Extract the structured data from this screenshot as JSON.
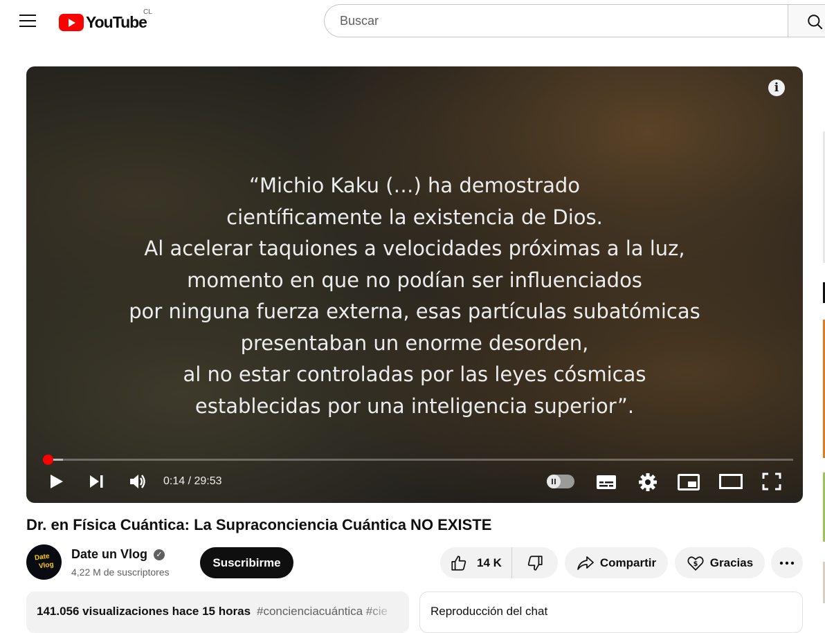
{
  "header": {
    "menu_icon": "hamburger-menu-icon",
    "logo_text": "YouTube",
    "country_code": "CL",
    "search_placeholder": "Buscar",
    "search_icon": "search-icon"
  },
  "player": {
    "quote_lines": [
      "“Michio Kaku (…) ha demostrado",
      "científicamente la existencia de Dios.",
      "Al acelerar taquiones a velocidades próximas a la luz,",
      "momento en que no podían ser influenciados",
      "por ninguna fuerza externa, esas partículas subatómicas",
      "presentaban un enorme desorden,",
      "al no estar controladas por las leyes cósmicas",
      "establecidas por una inteligencia superior”."
    ],
    "current_time": "0:14",
    "duration": "29:53",
    "time_display": "0:14 / 29:53",
    "progress_fraction": 0.0078,
    "buffered_fraction": 0.027,
    "controls": [
      "play-icon",
      "next-icon",
      "volume-icon",
      "autoplay-toggle",
      "subtitles-icon",
      "settings-icon",
      "miniplayer-icon",
      "theater-mode-icon",
      "fullscreen-icon"
    ],
    "info_icon": "info-icon"
  },
  "video": {
    "title": "Dr. en Física Cuántica: La Supraconciencia Cuántica NO EXISTE"
  },
  "channel": {
    "name": "Date un Vlog",
    "avatar_text_line1": "Date",
    "avatar_text_line2": "Vlog",
    "subscribers": "4,22 M de suscriptores",
    "subscribe_label": "Suscribirme",
    "verified_icon": "verified-badge-icon"
  },
  "actions": {
    "like_count": "14 K",
    "share_label": "Compartir",
    "thanks_label": "Gracias",
    "more_icon": "more-options-icon"
  },
  "description": {
    "views": "141.056 visualizaciones",
    "published": "hace 15 horas",
    "views_line": "141.056 visualizaciones  hace 15 horas",
    "tags": "#concienciacuántica #cie"
  },
  "chat": {
    "label": "Reproducción del chat"
  },
  "colors": {
    "brand_red": "#ff0000",
    "text_primary": "#0f0f0f",
    "text_secondary": "#606060",
    "chip_bg": "#f2f2f2"
  }
}
